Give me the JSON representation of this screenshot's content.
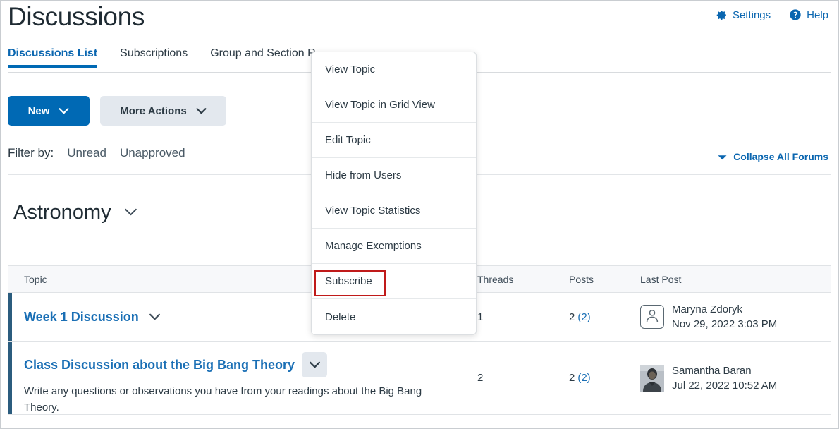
{
  "header": {
    "title": "Discussions",
    "actions": [
      {
        "label": "Settings",
        "icon": "gear-icon"
      },
      {
        "label": "Help",
        "icon": "help-circle-icon"
      }
    ]
  },
  "tabs": [
    {
      "label": "Discussions List",
      "active": true
    },
    {
      "label": "Subscriptions",
      "active": false
    },
    {
      "label": "Group and Section R",
      "active": false
    }
  ],
  "toolbar": {
    "new_label": "New",
    "more_actions_label": "More Actions"
  },
  "filters": {
    "label": "Filter by:",
    "options": [
      "Unread",
      "Unapproved"
    ]
  },
  "collapse_all": {
    "label": "Collapse All Forums",
    "icon": "caret-down-icon"
  },
  "forum": {
    "name": "Astronomy",
    "chevron_icon": "chevron-down-icon"
  },
  "table": {
    "columns": [
      "Topic",
      "Threads",
      "Posts",
      "Last Post"
    ],
    "rows": [
      {
        "topic": "Week 1 Discussion",
        "description": "",
        "threads": "1",
        "posts_total": "2",
        "posts_unread": "(2)",
        "last_post_author": "Maryna Zdoryk",
        "last_post_date": "Nov 29, 2022 3:03 PM",
        "avatar_type": "placeholder-person-icon"
      },
      {
        "topic": "Class Discussion about the Big Bang Theory",
        "description": "Write any questions or observations you have from your readings about the Big Bang Theory.",
        "threads": "2",
        "posts_total": "2",
        "posts_unread": "(2)",
        "last_post_author": "Samantha Baran",
        "last_post_date": "Jul 22, 2022 10:52 AM",
        "avatar_type": "photo"
      }
    ]
  },
  "context_menu": {
    "items": [
      {
        "label": "View Topic",
        "highlighted": false
      },
      {
        "label": "View Topic in Grid View",
        "highlighted": false
      },
      {
        "label": "Edit Topic",
        "highlighted": false
      },
      {
        "label": "Hide from Users",
        "highlighted": false
      },
      {
        "label": "View Topic Statistics",
        "highlighted": false
      },
      {
        "label": "Manage Exemptions",
        "highlighted": false
      },
      {
        "label": "Subscribe",
        "highlighted": true
      },
      {
        "label": "Delete",
        "highlighted": false
      }
    ]
  },
  "colors": {
    "accent_blue": "#0069b4",
    "link_blue": "#1a6fb5",
    "row_accent": "#2b5c7e",
    "highlight_red": "#c01a1a",
    "secondary_button": "#e3e8ee"
  }
}
